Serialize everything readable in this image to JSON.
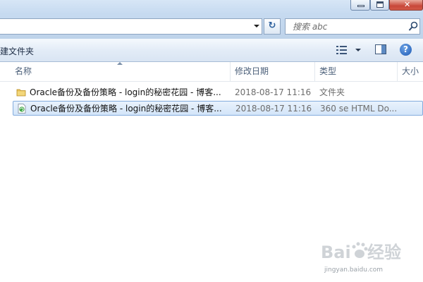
{
  "window": {
    "caption_buttons": [
      "minimize",
      "maximize",
      "close"
    ]
  },
  "address_bar": {
    "refresh_icon": "refresh-icon"
  },
  "search": {
    "placeholder": "搜索 abc",
    "icon": "search-icon"
  },
  "toolbar": {
    "new_folder_label": "建文件夹",
    "view_icon": "view-options-icon",
    "preview_pane_icon": "preview-pane-icon",
    "help_label": "?"
  },
  "columns": {
    "name": "名称",
    "date": "修改日期",
    "type": "类型",
    "size": "大小"
  },
  "files": [
    {
      "name": "Oracle备份及备份策略 - login的秘密花园 - 博客...",
      "date": "2018-08-17 11:16",
      "type": "文件夹",
      "icon": "folder-icon",
      "selected": false
    },
    {
      "name": "Oracle备份及备份策略 - login的秘密花园 - 博客...",
      "date": "2018-08-17 11:16",
      "type": "360 se HTML Do...",
      "icon": "html-document-icon",
      "selected": true
    }
  ],
  "watermark": {
    "brand": "Baidu经验",
    "site": "jingyan.baidu.com"
  },
  "colors": {
    "chrome": "#c6daf0",
    "selection": "#d3e5f9",
    "selection_border": "#84acdd",
    "close_red": "#c8483a"
  }
}
